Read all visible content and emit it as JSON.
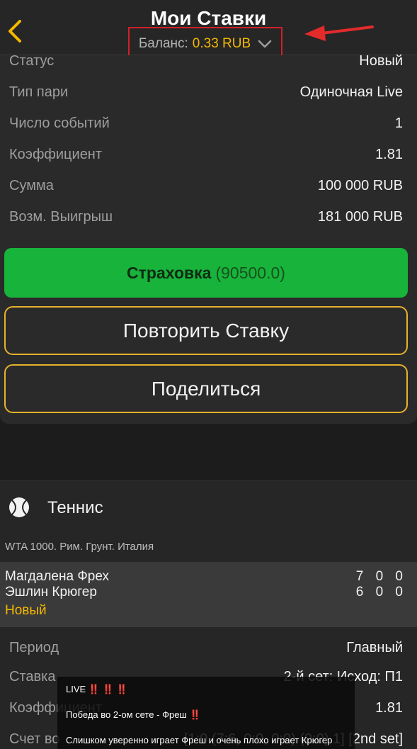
{
  "header": {
    "title": "Мои Ставки",
    "balance_label": "Баланс:",
    "balance_value": "0.33 RUB"
  },
  "bet": {
    "rows": [
      {
        "key": "Статус",
        "value": "Новый"
      },
      {
        "key": "Тип пари",
        "value": "Одиночная Live"
      },
      {
        "key": "Число событий",
        "value": "1"
      },
      {
        "key": "Коэффициент",
        "value": "1.81"
      },
      {
        "key": "Сумма",
        "value": "100 000 RUB"
      },
      {
        "key": "Возм. Выигрыш",
        "value": "181 000 RUB"
      }
    ],
    "insurance_label": "Страховка",
    "insurance_amount": "(90500.0)",
    "repeat_label": "Повторить Ставку",
    "share_label": "Поделиться"
  },
  "sport": {
    "name": "Теннис",
    "league": "WTA 1000. Рим. Грунт. Италия",
    "match": {
      "player1": "Магдалена Фрех",
      "player2": "Эшлин Крюгер",
      "score1": "7 0 0",
      "score2": "6 0 0",
      "status": "Новый"
    },
    "details": [
      {
        "key": "Период",
        "value": "Главный"
      },
      {
        "key": "Ставка",
        "value": "2-й сет: Исход: П1"
      },
      {
        "key": "Коэффициент",
        "value": "1.81"
      },
      {
        "key": "Счет во",
        "value": "[1:0 (7:6, 0:0, 0:0) (0:0) 1] [2nd set]"
      }
    ]
  },
  "overlay": {
    "line1": "LIVE",
    "line1_marks": "‼️ ‼️ ‼️",
    "line2": "Победа во 2-ом сете - Фреш",
    "line2_mark": "‼️",
    "line3": "Слишком уверенно играет Фреш и очень плохо играет Крюгер"
  },
  "colors": {
    "accent": "#f5b800",
    "insurance_green": "#18b33a",
    "outline": "#e6b22c",
    "highlight_box": "#d0202a"
  },
  "icons": [
    "chevron-left-icon",
    "chevron-down-icon",
    "red-arrow-annotation",
    "tennis-ball-icon"
  ]
}
